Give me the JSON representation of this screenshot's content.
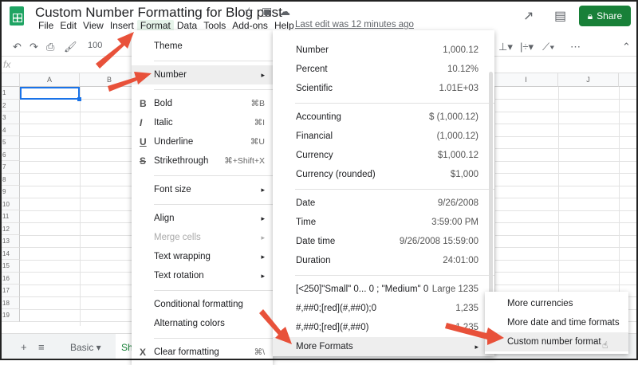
{
  "doc": {
    "title": "Custom Number Formatting for Blog post",
    "last_edit": "Last edit was 12 minutes ago",
    "share": "Share"
  },
  "menubar": [
    "File",
    "Edit",
    "View",
    "Insert",
    "Format",
    "Data",
    "Tools",
    "Add-ons",
    "Help"
  ],
  "toolbar": {
    "zoom": "100"
  },
  "formula_bar": {
    "fx": "fx"
  },
  "columns": [
    "A",
    "B",
    "I",
    "J"
  ],
  "rows": [
    "1",
    "2",
    "3",
    "4",
    "5",
    "6",
    "7",
    "8",
    "9",
    "10",
    "11",
    "12",
    "13",
    "14",
    "15",
    "16",
    "17",
    "18",
    "19"
  ],
  "sheets": {
    "add": "+",
    "list": "≡",
    "basic": "Basic",
    "current": "Sh"
  },
  "format_menu": [
    {
      "label": "Theme"
    },
    {
      "divider": true
    },
    {
      "label": "Number",
      "submenu": true,
      "highlight": true
    },
    {
      "divider": true
    },
    {
      "label": "Bold",
      "icon": "B",
      "shortcut": "⌘B"
    },
    {
      "label": "Italic",
      "icon": "I",
      "shortcut": "⌘I"
    },
    {
      "label": "Underline",
      "icon": "U",
      "shortcut": "⌘U"
    },
    {
      "label": "Strikethrough",
      "icon": "S",
      "shortcut": "⌘+Shift+X"
    },
    {
      "divider": true
    },
    {
      "label": "Font size",
      "submenu": true
    },
    {
      "divider": true
    },
    {
      "label": "Align",
      "submenu": true
    },
    {
      "label": "Merge cells",
      "submenu": true,
      "disabled": true
    },
    {
      "label": "Text wrapping",
      "submenu": true
    },
    {
      "label": "Text rotation",
      "submenu": true
    },
    {
      "divider": true
    },
    {
      "label": "Conditional formatting"
    },
    {
      "label": "Alternating colors"
    },
    {
      "divider": true
    },
    {
      "label": "Clear formatting",
      "icon": "X",
      "shortcut": "⌘\\"
    }
  ],
  "number_menu": [
    {
      "label": "Number",
      "value": "1,000.12"
    },
    {
      "label": "Percent",
      "value": "10.12%"
    },
    {
      "label": "Scientific",
      "value": "1.01E+03"
    },
    {
      "divider": true
    },
    {
      "label": "Accounting",
      "value": "$ (1,000.12)"
    },
    {
      "label": "Financial",
      "value": "(1,000.12)"
    },
    {
      "label": "Currency",
      "value": "$1,000.12"
    },
    {
      "label": "Currency (rounded)",
      "value": "$1,000"
    },
    {
      "divider": true
    },
    {
      "label": "Date",
      "value": "9/26/2008"
    },
    {
      "label": "Time",
      "value": "3:59:00 PM"
    },
    {
      "label": "Date time",
      "value": "9/26/2008 15:59:00"
    },
    {
      "label": "Duration",
      "value": "24:01:00"
    },
    {
      "divider": true
    },
    {
      "label": "[<250]\"Small\" 0... 0 ; \"Medium\" 0",
      "value": "Large 1235"
    },
    {
      "label": "#,##0;[red](#,##0);0",
      "value": "1,235"
    },
    {
      "label": "#,##0;[red](#,##0)",
      "value": "1,235"
    },
    {
      "label": "More Formats",
      "submenu": true,
      "highlight": true
    }
  ],
  "more_formats_menu": [
    {
      "label": "More currencies"
    },
    {
      "label": "More date and time formats"
    },
    {
      "label": "Custom number format",
      "highlight": true
    }
  ],
  "colors": {
    "share": "#188038",
    "arrow": "#e8513a",
    "selection": "#1a73e8"
  }
}
